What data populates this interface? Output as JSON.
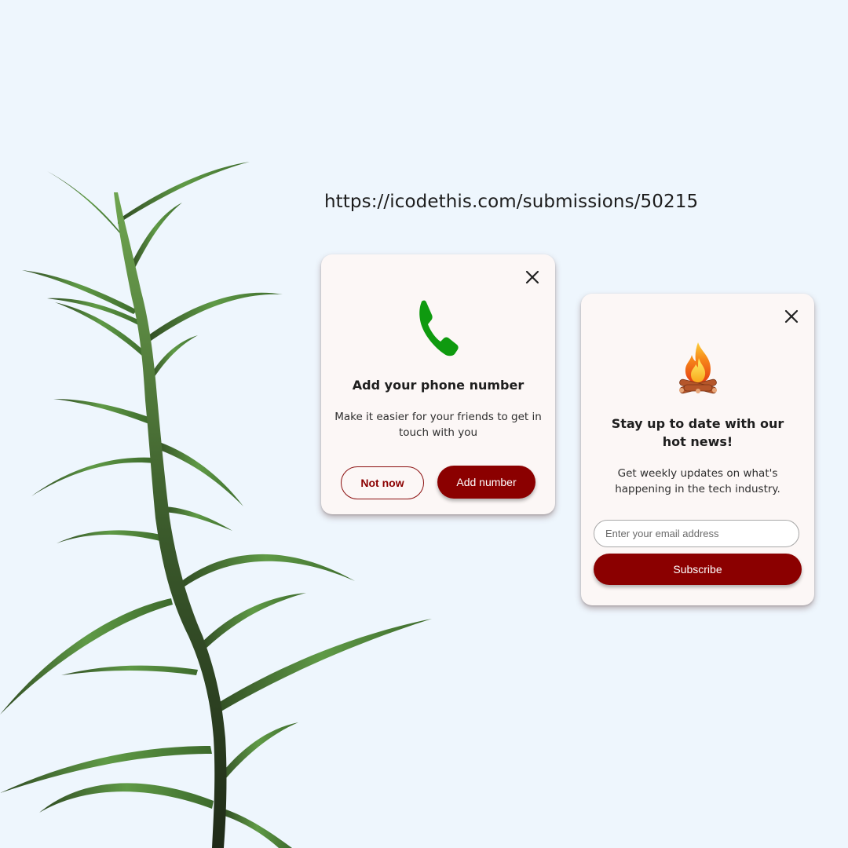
{
  "page": {
    "url_text": "https://icodethis.com/submissions/50215",
    "background": "#eef6fd"
  },
  "phone_card": {
    "icon": "phone-icon",
    "title": "Add your phone number",
    "description": "Make it easier for your friends to get in touch with you",
    "secondary_button": "Not now",
    "primary_button": "Add number",
    "close_icon": "close-icon"
  },
  "news_card": {
    "icon": "campfire-icon",
    "title": "Stay up to date with our hot news!",
    "description": "Get weekly updates on what's happening in the tech industry.",
    "email_placeholder": "Enter your email address",
    "email_value": "",
    "subscribe_button": "Subscribe",
    "close_icon": "close-icon"
  },
  "colors": {
    "accent": "#8b0000",
    "phone_icon": "#0f9a0f",
    "card_bg": "#fcf7f6"
  }
}
